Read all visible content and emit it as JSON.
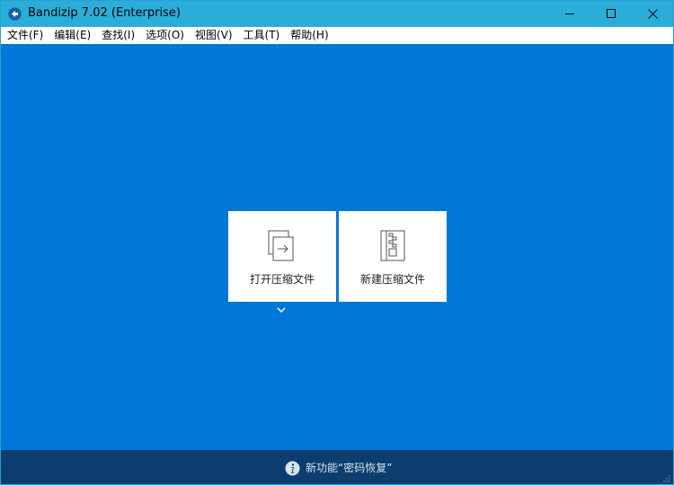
{
  "window": {
    "title": "Bandizip 7.02 (Enterprise)"
  },
  "menu": {
    "items": [
      {
        "label": "文件(F)"
      },
      {
        "label": "编辑(E)"
      },
      {
        "label": "查找(I)"
      },
      {
        "label": "选项(O)"
      },
      {
        "label": "视图(V)"
      },
      {
        "label": "工具(T)"
      },
      {
        "label": "帮助(H)"
      }
    ]
  },
  "main": {
    "open_archive_label": "打开压缩文件",
    "new_archive_label": "新建压缩文件"
  },
  "bottom": {
    "news_text": "新功能“密码恢复”"
  },
  "icons": {
    "app": "bandizip-logo-icon",
    "open": "open-archive-icon",
    "new": "new-archive-icon",
    "chevron": "chevron-down-icon",
    "info": "info-icon"
  },
  "colors": {
    "titlebar": "#2aaed9",
    "main_bg": "#0078d7",
    "bottom_bg": "#0b3e6f"
  }
}
